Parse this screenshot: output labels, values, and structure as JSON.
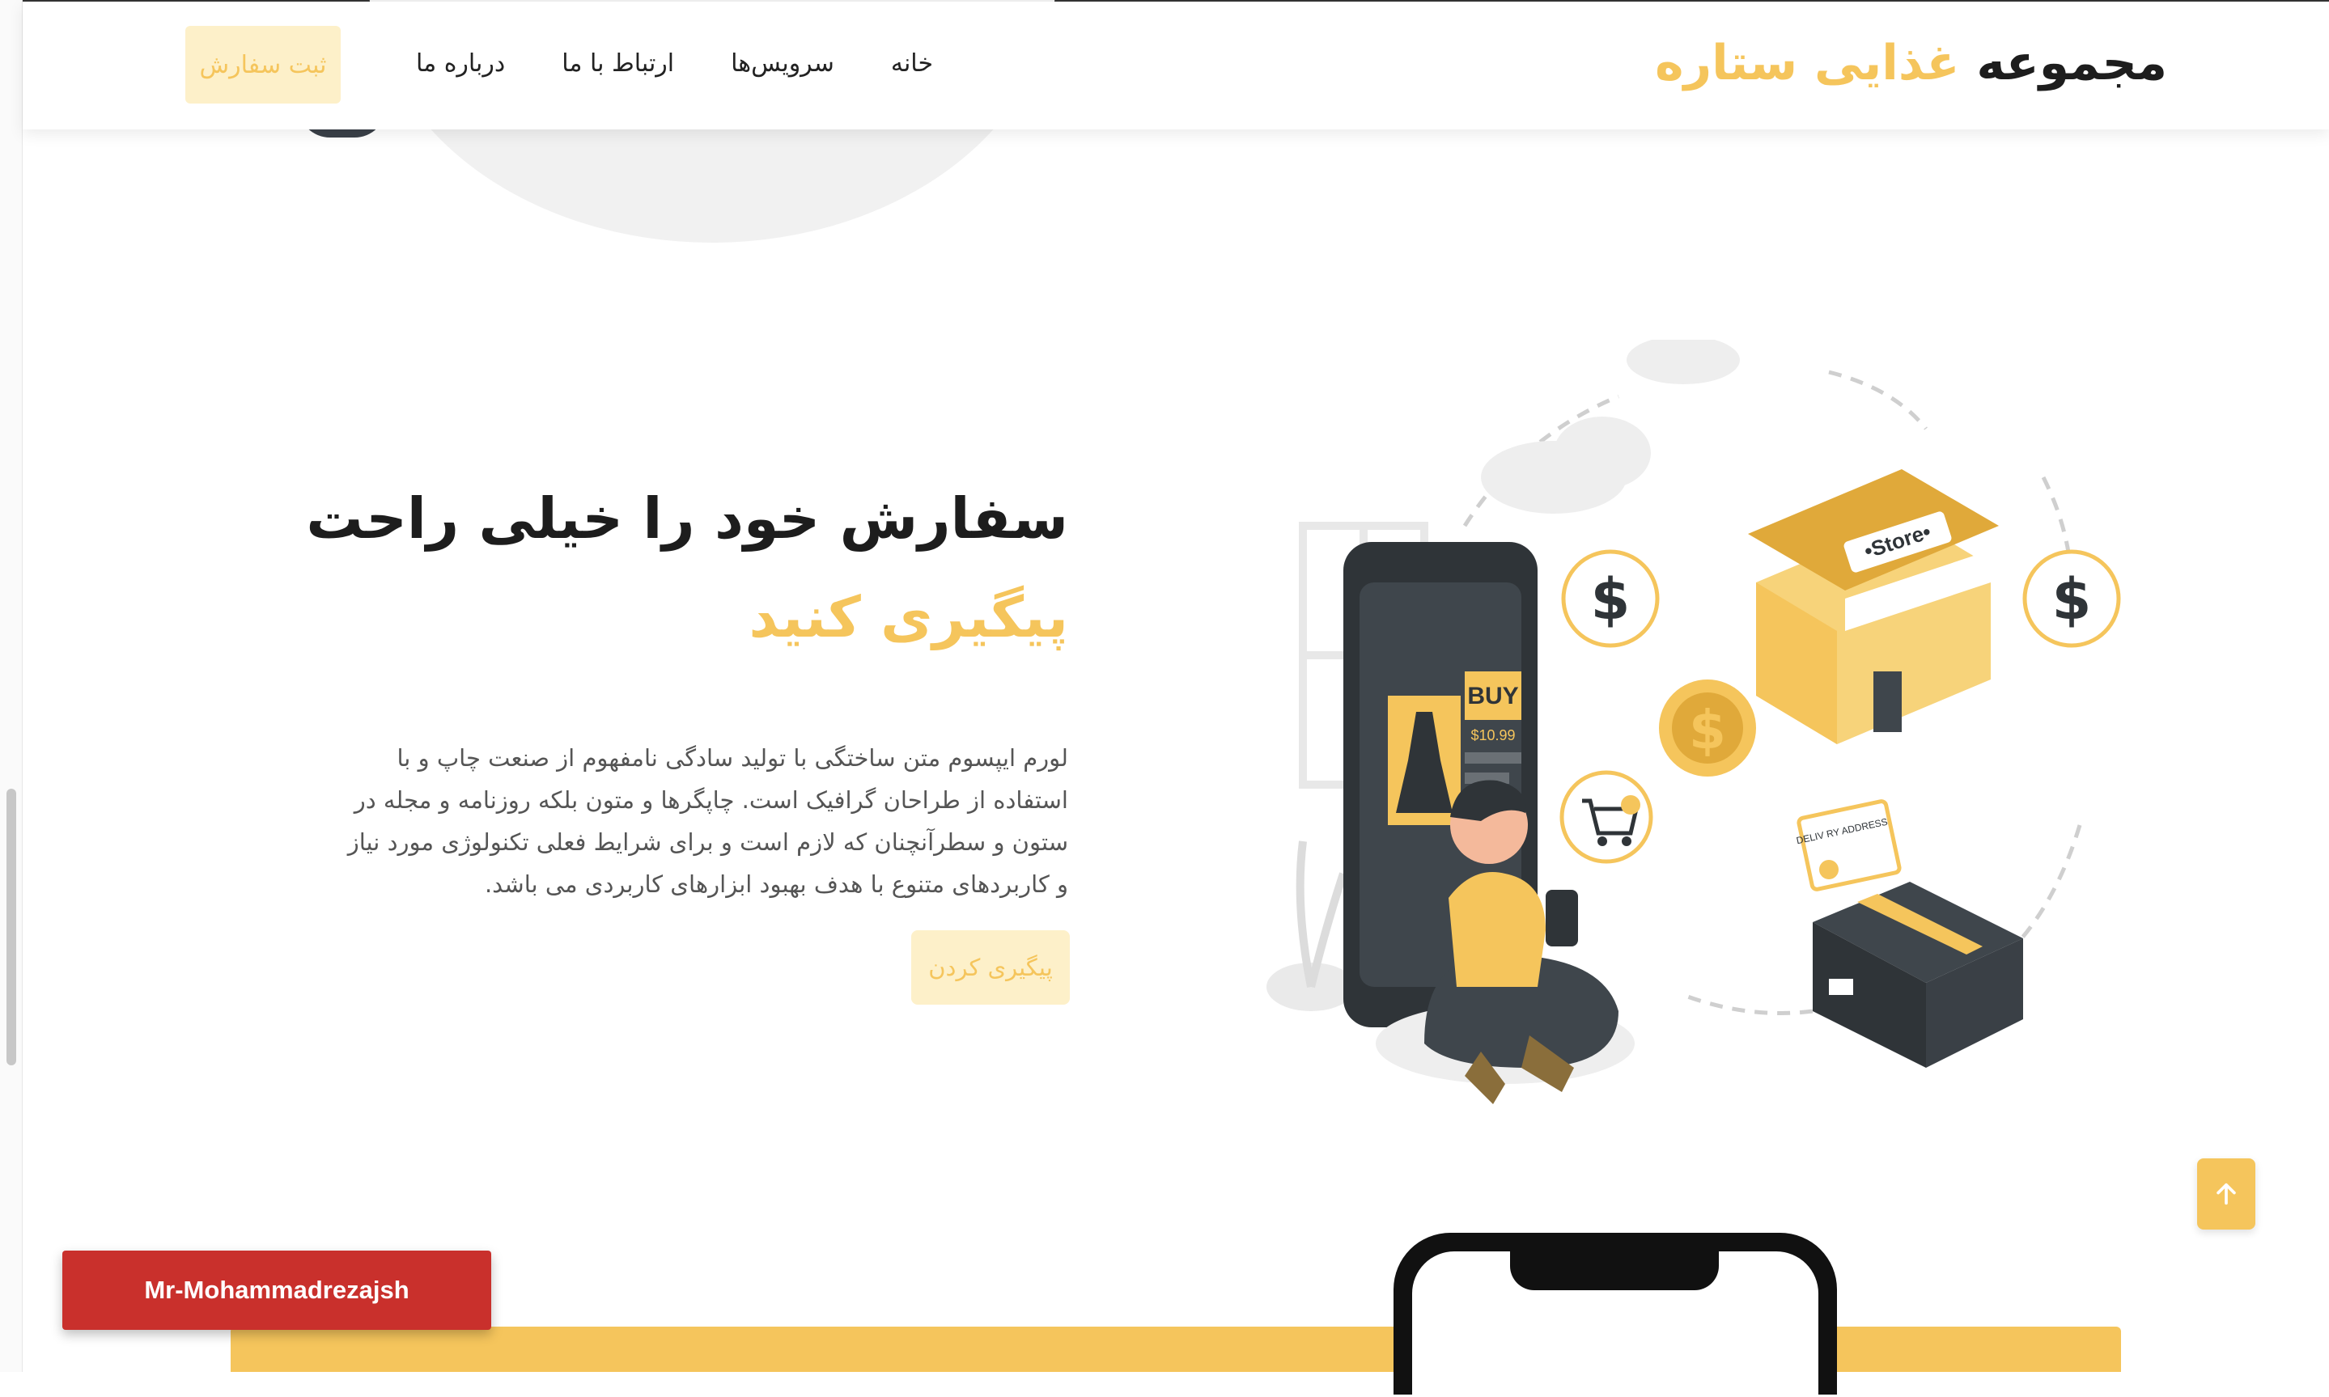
{
  "header": {
    "brand_main": "مجموعه",
    "brand_accent": "غذایی ستاره",
    "nav": {
      "home": "خانه",
      "services": "سرویس‌ها",
      "contact": "ارتباط با ما",
      "about": "درباره ما"
    },
    "order_button": "ثبت سفارش"
  },
  "hero": {
    "title_line1": "سفارش خود را خیلی راحت",
    "title_line2": "پیگیری کنید",
    "description": "لورم ایپسوم متن ساختگی با تولید سادگی نامفهوم از صنعت چاپ و با استفاده از طراحان گرافیک است. چاپگرها و متون بلکه روزنامه و مجله در ستون و سطرآنچنان که لازم است و برای شرایط فعلی تکنولوژی مورد نیاز و کاربردهای متنوع با هدف بهبود ابزارهای کاربردی می باشد.",
    "track_button": "پیگیری کردن"
  },
  "illustration": {
    "store_sign": "•Store•",
    "buy_label": "BUY",
    "price": "$10.99",
    "address_label": "DELIV RY ADDRESS",
    "dollar_symbol": "$"
  },
  "credit": "Mr-Mohammadrezajsh",
  "colors": {
    "accent": "#f5c55c",
    "accent_light": "#fdf0c9",
    "dark": "#1d1d1d",
    "credit_red": "#c9302c"
  },
  "icons": {
    "to_top": "arrow-up-icon",
    "cart": "shopping-cart-icon",
    "dollar": "dollar-coin-icon"
  }
}
